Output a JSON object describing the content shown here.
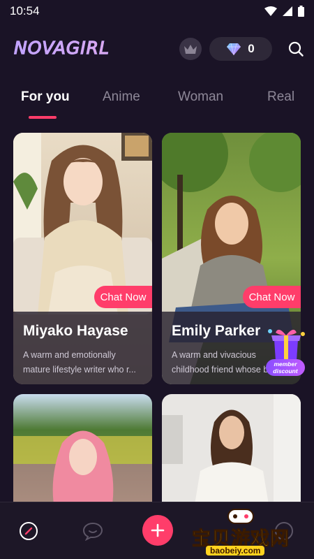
{
  "status_bar": {
    "time": "10:54"
  },
  "header": {
    "logo": "NOVAGIRL",
    "diamond_count": "0",
    "icons": {
      "crown": "crown-icon",
      "diamond": "diamond-icon",
      "search": "search-icon"
    }
  },
  "tabs": [
    {
      "label": "For you",
      "active": true
    },
    {
      "label": "Anime",
      "active": false
    },
    {
      "label": "Woman",
      "active": false
    },
    {
      "label": "Real",
      "active": false
    }
  ],
  "cards": [
    {
      "name": "Miyako Hayase",
      "cta": "Chat Now",
      "desc_line1": "A warm and emotionally",
      "desc_line2": "mature lifestyle writer who r..."
    },
    {
      "name": "Emily Parker",
      "cta": "Chat Now",
      "desc_line1": "A warm and vivacious",
      "desc_line2": "childhood friend whose b..."
    },
    {
      "name": "",
      "cta": ""
    },
    {
      "name": "",
      "cta": ""
    }
  ],
  "member_badge": {
    "line1": "member",
    "line2": "discount"
  },
  "bottom_nav": {
    "items": [
      "discover-icon",
      "chat-icon",
      "add-icon",
      "profile-icon"
    ]
  },
  "watermark": {
    "text": "宝贝游戏网",
    "url": "baobeiy.com"
  },
  "colors": {
    "accent": "#ff3d6a",
    "background": "#1a1326",
    "card_info": "#282230"
  }
}
